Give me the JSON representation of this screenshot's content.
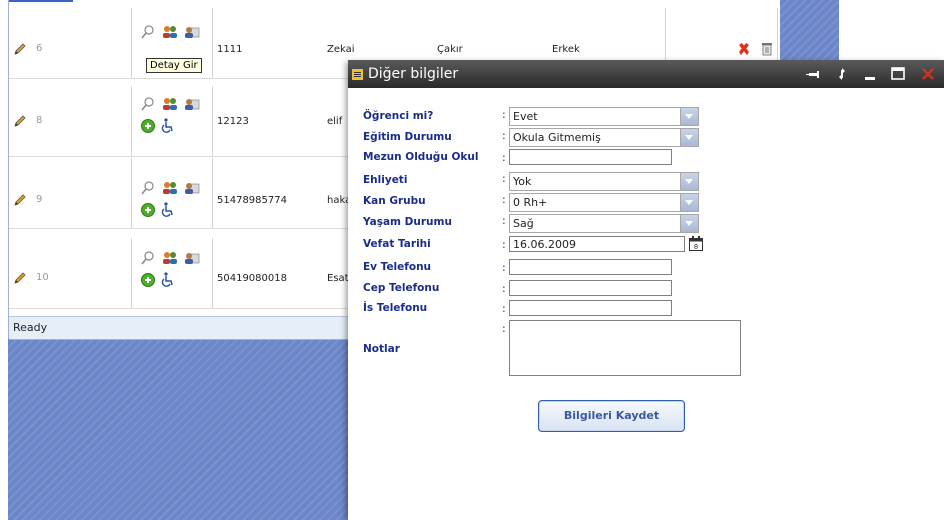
{
  "grid": {
    "rows": [
      {
        "num": "6",
        "tc": "1111",
        "name": "Zekai",
        "surname": "Çakır",
        "gender": "Erkek"
      },
      {
        "num": "8",
        "tc": "12123",
        "name": "elif",
        "surname": "",
        "gender": ""
      },
      {
        "num": "9",
        "tc": "51478985774",
        "name": "haka",
        "surname": "",
        "gender": ""
      },
      {
        "num": "10",
        "tc": "50419080018",
        "name": "Esat",
        "surname": "",
        "gender": ""
      }
    ],
    "tooltip": "Detay Gir",
    "status": "Ready"
  },
  "dialog": {
    "title": "Diğer bilgiler",
    "fields": {
      "ogrenci": {
        "label": "Öğrenci mi?",
        "value": "Evet"
      },
      "egitim": {
        "label": "Eğitim Durumu",
        "value": "Okula Gitmemiş"
      },
      "mezun": {
        "label": "Mezun Olduğu Okul",
        "value": ""
      },
      "ehliyet": {
        "label": "Ehliyeti",
        "value": "Yok"
      },
      "kan": {
        "label": "Kan Grubu",
        "value": "0 Rh+"
      },
      "yasam": {
        "label": "Yaşam Durumu",
        "value": "Sağ"
      },
      "vefat": {
        "label": "Vefat Tarihi",
        "value": "16.06.2009"
      },
      "ev": {
        "label": "Ev Telefonu",
        "value": ""
      },
      "cep": {
        "label": "Cep Telefonu",
        "value": ""
      },
      "is": {
        "label": "İs Telefonu",
        "value": ""
      },
      "notlar": {
        "label": "Notlar",
        "value": ""
      }
    },
    "colon": ":",
    "save_label": "Bilgileri Kaydet"
  },
  "icons": [
    "pencil-icon",
    "search-icon",
    "users-icon",
    "user-card-icon",
    "add-icon",
    "wheelchair-icon",
    "delete-icon",
    "trash-icon",
    "calendar-icon",
    "pin-icon",
    "refresh-icon",
    "minimize-icon",
    "maximize-icon",
    "close-icon"
  ],
  "colors": {
    "accent": "#1a2c8a",
    "titlebar": "#3a3a3a",
    "background": "#6b86c9",
    "close": "#e03020"
  }
}
